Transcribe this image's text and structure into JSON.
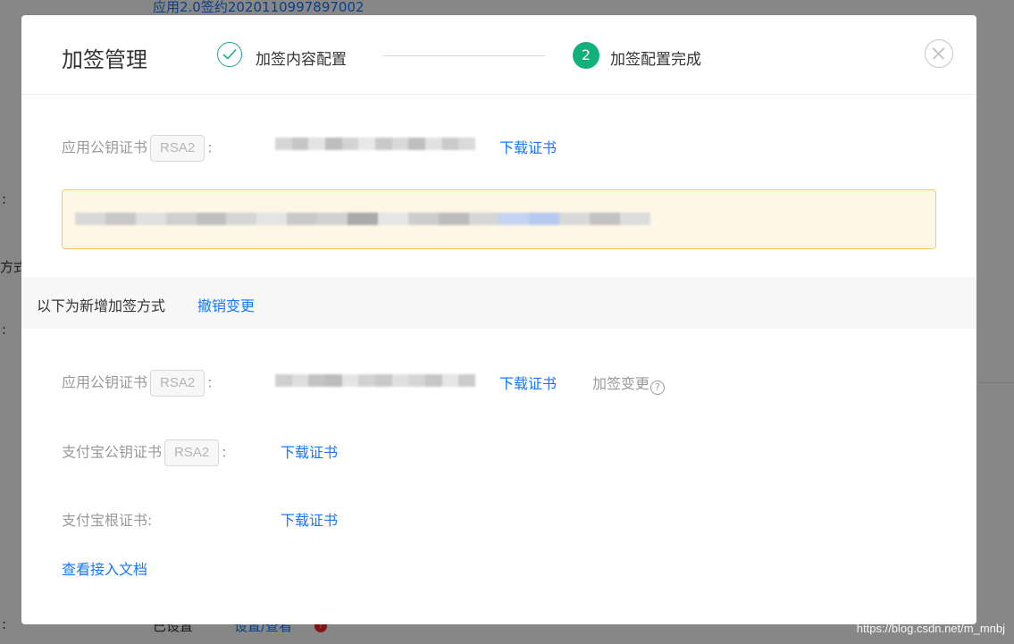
{
  "background": {
    "top_link": "应用2.0签约2020110997897002",
    "bottom_status": "已设置",
    "bottom_link": "设置/查看",
    "bottom_badge": "!",
    "left_fragment_1": ":",
    "left_fragment_2": "方式",
    "left_fragment_3": ":",
    "left_fragment_4": ":"
  },
  "modal": {
    "title": "加签管理",
    "steps": [
      {
        "label": "加签内容配置",
        "status": "done"
      },
      {
        "label": "加签配置完成",
        "number": "2",
        "status": "active"
      }
    ],
    "current": {
      "app_cert_label": "应用公钥证书",
      "tag": "RSA2",
      "colon": ":",
      "download_label": "下载证书"
    },
    "section": {
      "title": "以下为新增加签方式",
      "revoke_label": "撤销变更"
    },
    "new": {
      "app_cert_label": "应用公钥证书",
      "app_cert_tag": "RSA2",
      "colon": ":",
      "app_cert_download": "下载证书",
      "change_label": "加签变更",
      "help_glyph": "?",
      "alipay_cert_label": "支付宝公钥证书",
      "alipay_cert_tag": "RSA2",
      "alipay_cert_download": "下载证书",
      "root_cert_label": "支付宝根证书:",
      "root_cert_download": "下载证书"
    },
    "docs_link": "查看接入文档"
  },
  "watermark": "https://blog.csdn.net/m_mnbj",
  "colors": {
    "accent": "#1677ff",
    "success": "#12b07c",
    "notice_bg": "#fff7e6",
    "notice_border": "#fac858"
  },
  "icons": [
    "check-icon",
    "close-icon",
    "help-icon"
  ]
}
